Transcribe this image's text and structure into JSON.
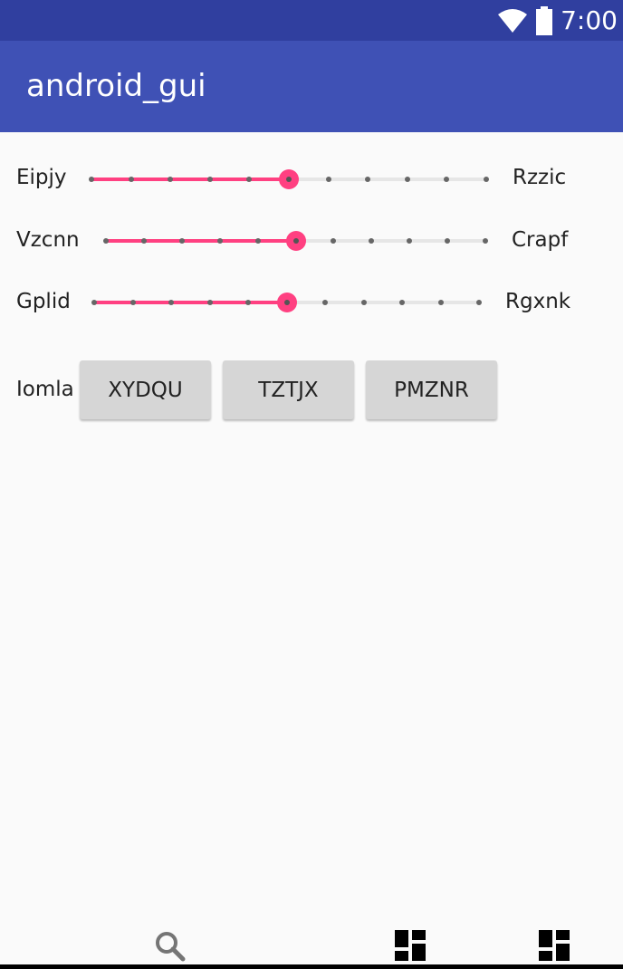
{
  "status_bar": {
    "time": "7:00",
    "icons": [
      "wifi-icon",
      "battery-icon"
    ]
  },
  "app_bar": {
    "title": "android_gui"
  },
  "sliders": [
    {
      "label_left": "Eipjy",
      "label_right": "Rzzic",
      "ticks": 11,
      "value": 5
    },
    {
      "label_left": "Vzcnn",
      "label_right": "Crapf",
      "ticks": 11,
      "value": 5
    },
    {
      "label_left": "Gplid",
      "label_right": "Rgxnk",
      "ticks": 11,
      "value": 5
    }
  ],
  "button_row": {
    "label": "Iomla",
    "buttons": [
      "XYDQU",
      "TZTJX",
      "PMZNR"
    ]
  },
  "bottom_bar": {
    "icons": [
      "search-icon",
      "dashboard-icon",
      "dashboard-icon"
    ]
  },
  "colors": {
    "status_bar": "#303f9f",
    "app_bar": "#3f51b5",
    "accent": "#ff4081",
    "background": "#fafafa"
  }
}
